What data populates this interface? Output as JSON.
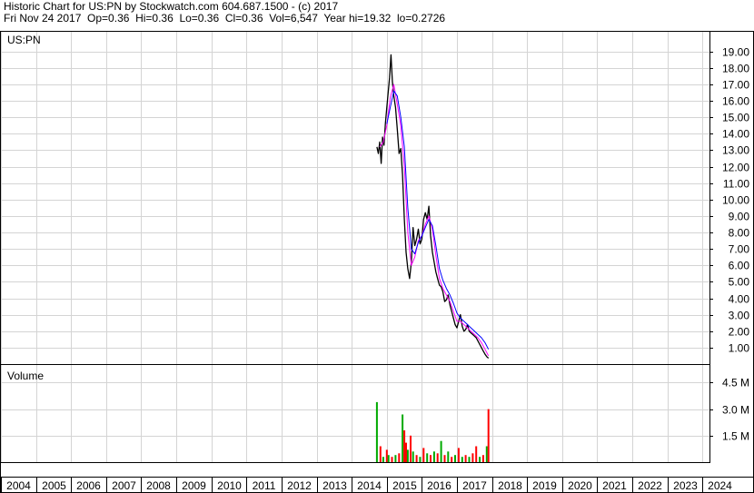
{
  "header": {
    "line1": "Historic Chart for US:PN by Stockwatch.com 604.687.1500 - (c) 2017",
    "line2": "Fri Nov 24 2017  Op=0.36  Hi=0.36  Lo=0.36  Cl=0.36  Vol=6,547  Year hi=19.32  lo=0.2726"
  },
  "colors": {
    "price": "#000000",
    "ma_short": "#ff00ff",
    "ma_long": "#0000ff",
    "volume_up": "#00aa00",
    "volume_down": "#ff0000",
    "grid": "#d4d4d4"
  },
  "chart_data": [
    {
      "type": "line",
      "title": "US:PN",
      "x_tick_labels": [
        "2004",
        "2005",
        "2006",
        "2007",
        "2008",
        "2009",
        "2010",
        "2011",
        "2012",
        "2013",
        "2014",
        "2015",
        "2016",
        "2017",
        "2018",
        "2019",
        "2020",
        "2021",
        "2022",
        "2023",
        "2024"
      ],
      "y_tick_labels": [
        "1.00",
        "2.00",
        "3.00",
        "4.00",
        "5.00",
        "6.00",
        "7.00",
        "8.00",
        "9.00",
        "10.00",
        "11.00",
        "12.00",
        "13.00",
        "14.00",
        "15.00",
        "16.00",
        "17.00",
        "18.00",
        "19.00"
      ],
      "xlim": [
        2004,
        2024.2
      ],
      "ylim": [
        0,
        20.2
      ],
      "grid": true,
      "series": [
        {
          "role": "price",
          "x": [
            2014.72,
            2014.76,
            2014.8,
            2014.84,
            2014.88,
            2014.92,
            2014.96,
            2015.0,
            2015.04,
            2015.08,
            2015.12,
            2015.16,
            2015.2,
            2015.25,
            2015.3,
            2015.35,
            2015.4,
            2015.45,
            2015.5,
            2015.55,
            2015.6,
            2015.65,
            2015.7,
            2015.75,
            2015.8,
            2015.85,
            2015.9,
            2015.95,
            2016.0,
            2016.05,
            2016.1,
            2016.15,
            2016.2,
            2016.25,
            2016.3,
            2016.35,
            2016.4,
            2016.45,
            2016.5,
            2016.55,
            2016.6,
            2016.65,
            2016.7,
            2016.75,
            2016.8,
            2016.85,
            2016.9,
            2016.95,
            2017.0,
            2017.05,
            2017.1,
            2017.15,
            2017.2,
            2017.25,
            2017.3,
            2017.35,
            2017.4,
            2017.45,
            2017.5,
            2017.55,
            2017.6,
            2017.65,
            2017.7,
            2017.75,
            2017.8,
            2017.85,
            2017.9
          ],
          "y": [
            13.2,
            12.8,
            13.5,
            12.2,
            13.8,
            13.3,
            14.6,
            15.6,
            16.5,
            17.4,
            18.8,
            17.2,
            16.3,
            15.6,
            14.3,
            12.8,
            13.1,
            11.5,
            8.8,
            6.8,
            5.8,
            5.2,
            6.2,
            8.3,
            7.2,
            7.6,
            8.2,
            7.3,
            7.6,
            8.8,
            9.2,
            8.8,
            9.6,
            7.8,
            6.8,
            6.2,
            5.6,
            5.2,
            4.8,
            4.7,
            4.4,
            3.8,
            3.9,
            4.2,
            3.6,
            3.2,
            2.8,
            2.4,
            2.2,
            2.6,
            3.0,
            2.3,
            2.0,
            2.1,
            2.4,
            2.0,
            1.9,
            1.8,
            1.7,
            1.6,
            1.4,
            1.2,
            1.0,
            0.8,
            0.6,
            0.45,
            0.36
          ]
        },
        {
          "role": "ma_short",
          "x": [
            2014.8,
            2014.9,
            2015.0,
            2015.1,
            2015.2,
            2015.3,
            2015.4,
            2015.5,
            2015.6,
            2015.7,
            2015.8,
            2015.9,
            2016.0,
            2016.1,
            2016.2,
            2016.3,
            2016.4,
            2016.5,
            2016.6,
            2016.7,
            2016.8,
            2016.9,
            2017.0,
            2017.1,
            2017.2,
            2017.3,
            2017.4,
            2017.5,
            2017.6,
            2017.7,
            2017.8,
            2017.9
          ],
          "y": [
            13.2,
            13.5,
            14.5,
            16.2,
            17.0,
            15.8,
            14.5,
            12.0,
            8.0,
            6.0,
            6.5,
            7.5,
            7.8,
            8.5,
            9.0,
            8.2,
            6.6,
            5.2,
            4.6,
            4.2,
            3.8,
            3.2,
            2.6,
            2.6,
            2.4,
            2.2,
            2.0,
            1.8,
            1.6,
            1.3,
            0.9,
            0.5
          ]
        },
        {
          "role": "ma_long",
          "x": [
            2015.0,
            2015.1,
            2015.2,
            2015.3,
            2015.4,
            2015.5,
            2015.6,
            2015.7,
            2015.8,
            2015.9,
            2016.0,
            2016.1,
            2016.2,
            2016.3,
            2016.4,
            2016.5,
            2016.6,
            2016.7,
            2016.8,
            2016.9,
            2017.0,
            2017.1,
            2017.2,
            2017.3,
            2017.4,
            2017.5,
            2017.6,
            2017.7,
            2017.8,
            2017.9
          ],
          "y": [
            14.6,
            15.6,
            16.6,
            16.3,
            15.0,
            13.2,
            9.5,
            7.0,
            6.7,
            7.4,
            7.8,
            8.3,
            8.8,
            8.4,
            7.2,
            5.8,
            5.1,
            4.6,
            4.2,
            3.7,
            3.1,
            2.8,
            2.6,
            2.4,
            2.2,
            2.0,
            1.8,
            1.6,
            1.3,
            0.9
          ]
        }
      ]
    },
    {
      "type": "bar",
      "title": "Volume",
      "y_tick_labels": [
        "1.5 M",
        "3.0 M",
        "4.5 M"
      ],
      "ylim": [
        0,
        5.5
      ],
      "unit": "M",
      "grid": true,
      "x": [
        2014.72,
        2014.82,
        2014.9,
        2015.0,
        2015.05,
        2015.15,
        2015.25,
        2015.35,
        2015.45,
        2015.5,
        2015.55,
        2015.6,
        2015.68,
        2015.75,
        2015.85,
        2015.95,
        2016.05,
        2016.15,
        2016.25,
        2016.35,
        2016.45,
        2016.55,
        2016.65,
        2016.75,
        2016.85,
        2016.95,
        2017.05,
        2017.15,
        2017.25,
        2017.35,
        2017.45,
        2017.55,
        2017.65,
        2017.75,
        2017.85,
        2017.9
      ],
      "values": [
        3.4,
        0.9,
        0.3,
        0.7,
        0.4,
        0.3,
        0.4,
        0.5,
        2.7,
        1.8,
        1.1,
        0.7,
        1.5,
        0.6,
        0.4,
        0.3,
        0.8,
        0.5,
        0.4,
        0.6,
        0.5,
        1.2,
        0.4,
        0.6,
        0.3,
        0.4,
        0.8,
        0.3,
        0.4,
        0.3,
        0.5,
        0.9,
        0.3,
        0.4,
        0.9,
        3.0
      ],
      "direction": [
        "up",
        "down",
        "up",
        "down",
        "up",
        "down",
        "up",
        "down",
        "up",
        "down",
        "down",
        "up",
        "down",
        "up",
        "down",
        "up",
        "down",
        "up",
        "down",
        "up",
        "down",
        "up",
        "down",
        "up",
        "down",
        "up",
        "down",
        "up",
        "down",
        "up",
        "down",
        "down",
        "up",
        "down",
        "up",
        "down"
      ]
    }
  ]
}
